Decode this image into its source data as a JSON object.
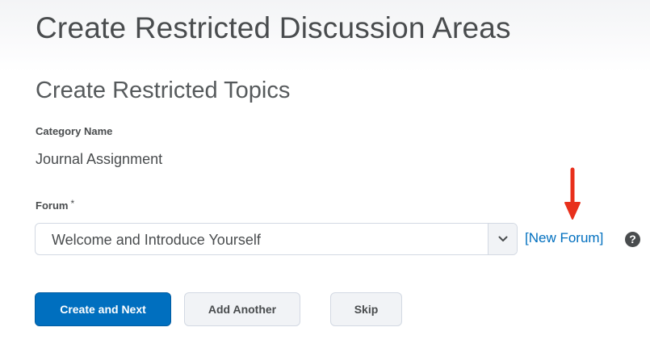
{
  "page": {
    "title": "Create Restricted Discussion Areas"
  },
  "section": {
    "title": "Create Restricted Topics"
  },
  "category": {
    "label": "Category Name",
    "value": "Journal Assignment"
  },
  "forum": {
    "label": "Forum",
    "required_marker": "*",
    "selected_value": "Welcome and Introduce Yourself",
    "new_forum_link": "[New Forum]",
    "help_icon": "?"
  },
  "buttons": {
    "create_and_next": "Create and Next",
    "add_another": "Add Another",
    "skip": "Skip"
  },
  "icons": {
    "select_arrow": "chevron-down-icon",
    "help": "help-icon",
    "annotation": "red-arrow-down-icon"
  },
  "colors": {
    "primary": "#006fbf",
    "link": "#006fbf",
    "text": "#494c4e",
    "annotation": "#e8301c"
  }
}
